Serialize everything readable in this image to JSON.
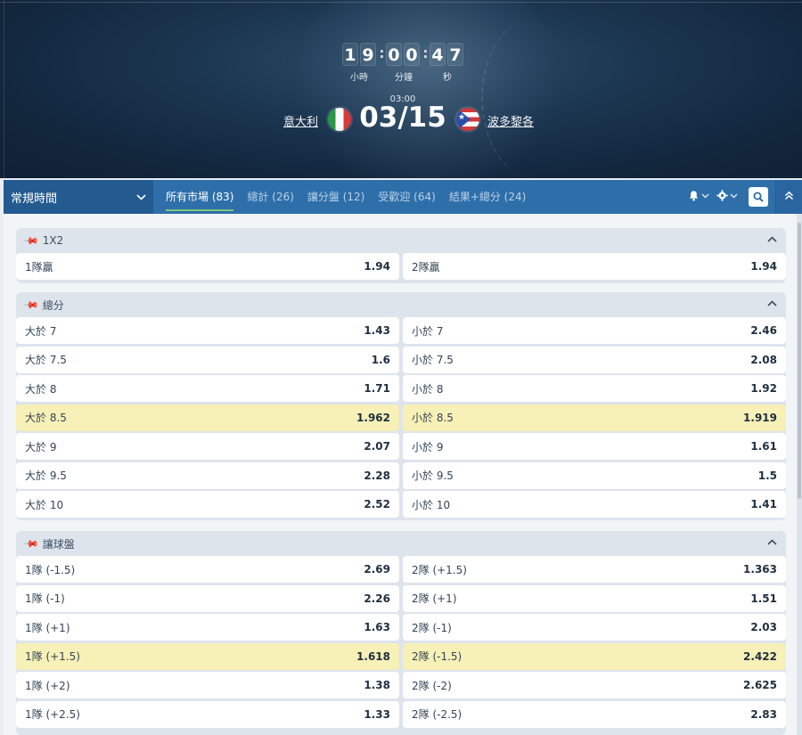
{
  "timer": {
    "hours": [
      "1",
      "9"
    ],
    "minutes": [
      "0",
      "0"
    ],
    "seconds": [
      "4",
      "7"
    ],
    "label_hours": "小時",
    "label_minutes": "分鐘",
    "label_seconds": "秒"
  },
  "match": {
    "time": "03:00",
    "date": "03/15",
    "home": "意大利",
    "away": "波多黎各"
  },
  "nav": {
    "period": "常規時間",
    "tabs": [
      {
        "label": "所有市場 (83)"
      },
      {
        "label": "總計 (26)"
      },
      {
        "label": "讓分盤 (12)"
      },
      {
        "label": "受歡迎 (64)"
      },
      {
        "label": "結果+總分 (24)"
      }
    ]
  },
  "markets": [
    {
      "title": "1X2",
      "rows": [
        [
          {
            "label": "1隊贏",
            "odds": "1.94"
          },
          {
            "label": "2隊贏",
            "odds": "1.94"
          }
        ]
      ]
    },
    {
      "title": "總分",
      "rows": [
        [
          {
            "label": "大於 7",
            "odds": "1.43"
          },
          {
            "label": "小於 7",
            "odds": "2.46"
          }
        ],
        [
          {
            "label": "大於 7.5",
            "odds": "1.6"
          },
          {
            "label": "小於 7.5",
            "odds": "2.08"
          }
        ],
        [
          {
            "label": "大於 8",
            "odds": "1.71"
          },
          {
            "label": "小於 8",
            "odds": "1.92"
          }
        ],
        [
          {
            "label": "大於 8.5",
            "odds": "1.962"
          },
          {
            "label": "小於 8.5",
            "odds": "1.919"
          }
        ],
        [
          {
            "label": "大於 9",
            "odds": "2.07"
          },
          {
            "label": "小於 9",
            "odds": "1.61"
          }
        ],
        [
          {
            "label": "大於 9.5",
            "odds": "2.28"
          },
          {
            "label": "小於 9.5",
            "odds": "1.5"
          }
        ],
        [
          {
            "label": "大於 10",
            "odds": "2.52"
          },
          {
            "label": "小於 10",
            "odds": "1.41"
          }
        ]
      ]
    },
    {
      "title": "讓球盤",
      "rows": [
        [
          {
            "label": "1隊 (-1.5)",
            "odds": "2.69"
          },
          {
            "label": "2隊 (+1.5)",
            "odds": "1.363"
          }
        ],
        [
          {
            "label": "1隊 (-1)",
            "odds": "2.26"
          },
          {
            "label": "2隊 (+1)",
            "odds": "1.51"
          }
        ],
        [
          {
            "label": "1隊 (+1)",
            "odds": "1.63"
          },
          {
            "label": "2隊 (-1)",
            "odds": "2.03"
          }
        ],
        [
          {
            "label": "1隊 (+1.5)",
            "odds": "1.618"
          },
          {
            "label": "2隊 (-1.5)",
            "odds": "2.422"
          }
        ],
        [
          {
            "label": "1隊 (+2)",
            "odds": "1.38"
          },
          {
            "label": "2隊 (-2)",
            "odds": "2.625"
          }
        ],
        [
          {
            "label": "1隊 (+2.5)",
            "odds": "1.33"
          },
          {
            "label": "2隊 (-2.5)",
            "odds": "2.83"
          }
        ]
      ]
    }
  ],
  "colors": {
    "accent": "#2e6faa",
    "highlight_row": "#f7f0b7",
    "active_tab_underline": "#7fc47a"
  },
  "icons": [
    "pin-icon",
    "bell-icon",
    "gear-icon",
    "search-icon",
    "chevron-up-icon",
    "chevron-down-icon"
  ]
}
